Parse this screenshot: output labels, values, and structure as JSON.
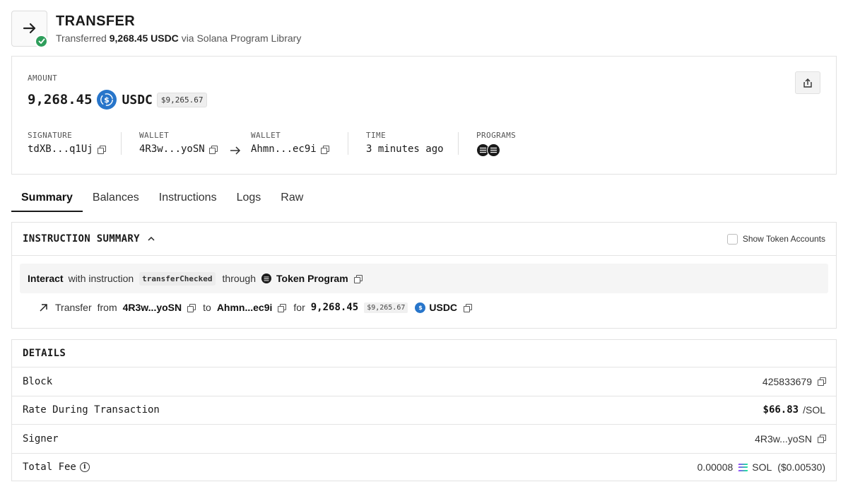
{
  "header": {
    "title": "TRANSFER",
    "sub_prefix": "Transferred",
    "sub_amount": "9,268.45 USDC",
    "sub_suffix": "via Solana Program Library"
  },
  "overview": {
    "amount_label": "AMOUNT",
    "amount_value": "9,268.45",
    "amount_symbol": "USDC",
    "amount_usd": "$9,265.67",
    "signature_label": "SIGNATURE",
    "signature_value": "tdXB...q1Uj",
    "from_wallet_label": "WALLET",
    "from_wallet_value": "4R3w...yoSN",
    "to_wallet_label": "WALLET",
    "to_wallet_value": "Ahmn...ec9i",
    "time_label": "TIME",
    "time_value": "3 minutes ago",
    "programs_label": "PROGRAMS"
  },
  "tabs": [
    {
      "label": "Summary",
      "active": true
    },
    {
      "label": "Balances",
      "active": false
    },
    {
      "label": "Instructions",
      "active": false
    },
    {
      "label": "Logs",
      "active": false
    },
    {
      "label": "Raw",
      "active": false
    }
  ],
  "instruction_summary": {
    "title": "INSTRUCTION SUMMARY",
    "show_token_accounts_label": "Show Token Accounts",
    "show_token_accounts_checked": false,
    "interact_bold": "Interact",
    "with_instruction": "with instruction",
    "instruction_name": "transferChecked",
    "through": "through",
    "program_name": "Token Program",
    "transfer_word": "Transfer",
    "from_word": "from",
    "from_addr": "4R3w...yoSN",
    "to_word": "to",
    "to_addr": "Ahmn...ec9i",
    "for_word": "for",
    "amount": "9,268.45",
    "amount_usd": "$9,265.67",
    "symbol": "USDC"
  },
  "details": {
    "title": "DETAILS",
    "block_label": "Block",
    "block_value": "425833679",
    "rate_label": "Rate During Transaction",
    "rate_value": "$66.83",
    "rate_unit": "/SOL",
    "signer_label": "Signer",
    "signer_value": "4R3w...yoSN",
    "fee_label": "Total Fee",
    "fee_value": "0.00008",
    "fee_symbol": "SOL",
    "fee_usd": "($0.00530)"
  },
  "colors": {
    "usdc_blue": "#2775ca",
    "success_green": "#2e9e5b"
  },
  "icons": {
    "header": "arrow-right-icon",
    "status": "check-icon",
    "share": "share-icon",
    "copy": "copy-icon",
    "transfer": "arrow-up-right-icon"
  }
}
